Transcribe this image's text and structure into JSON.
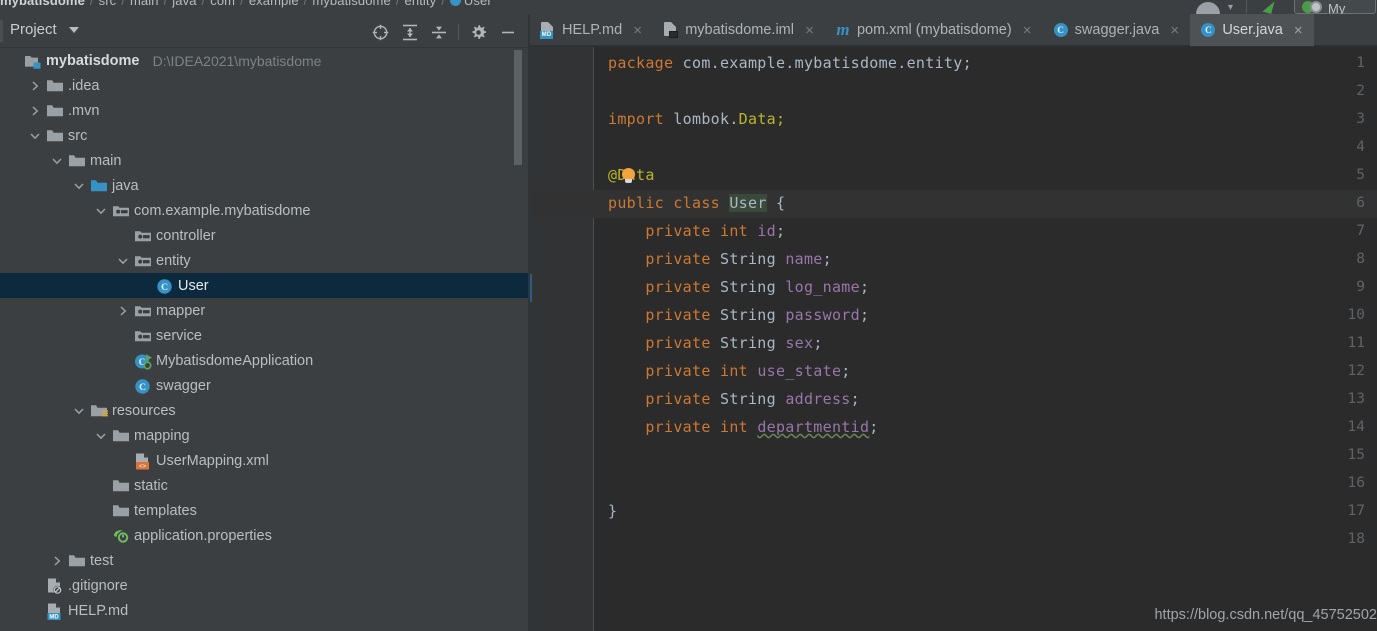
{
  "breadcrumb": {
    "items": [
      "mybatisdome",
      "src",
      "main",
      "java",
      "com",
      "example",
      "mybatisdome",
      "entity",
      "User"
    ],
    "separator": "/"
  },
  "toolbar_right": {
    "module_label": "My"
  },
  "project_panel": {
    "title": "Project",
    "caret_icon": "chevron-down-icon",
    "tools": [
      {
        "name": "select-opened-file-icon",
        "label": "Select Opened File"
      },
      {
        "name": "expand-all-icon",
        "label": "Expand All"
      },
      {
        "name": "collapse-all-icon",
        "label": "Collapse All"
      },
      {
        "name": "gear-icon",
        "label": "Settings"
      },
      {
        "name": "minimize-icon",
        "label": "Hide"
      }
    ],
    "tree": [
      {
        "label": "mybatisdome",
        "path": "D:\\IDEA2021\\mybatisdome",
        "depth": 0,
        "arrow": "none",
        "icon": "module-icon",
        "bold": true,
        "selected": false
      },
      {
        "label": ".idea",
        "path": "",
        "depth": 1,
        "arrow": "collapsed",
        "icon": "folder-icon",
        "bold": false,
        "selected": false
      },
      {
        "label": ".mvn",
        "path": "",
        "depth": 1,
        "arrow": "collapsed",
        "icon": "folder-icon",
        "bold": false,
        "selected": false
      },
      {
        "label": "src",
        "path": "",
        "depth": 1,
        "arrow": "expanded",
        "icon": "folder-icon",
        "bold": false,
        "selected": false
      },
      {
        "label": "main",
        "path": "",
        "depth": 2,
        "arrow": "expanded",
        "icon": "folder-icon",
        "bold": false,
        "selected": false
      },
      {
        "label": "java",
        "path": "",
        "depth": 3,
        "arrow": "expanded",
        "icon": "source-root-icon",
        "bold": false,
        "selected": false
      },
      {
        "label": "com.example.mybatisdome",
        "path": "",
        "depth": 4,
        "arrow": "expanded",
        "icon": "package-icon",
        "bold": false,
        "selected": false
      },
      {
        "label": "controller",
        "path": "",
        "depth": 5,
        "arrow": "none",
        "icon": "package-icon",
        "bold": false,
        "selected": false
      },
      {
        "label": "entity",
        "path": "",
        "depth": 5,
        "arrow": "expanded",
        "icon": "package-icon",
        "bold": false,
        "selected": false
      },
      {
        "label": "User",
        "path": "",
        "depth": 6,
        "arrow": "none",
        "icon": "java-class-icon",
        "bold": false,
        "selected": true
      },
      {
        "label": "mapper",
        "path": "",
        "depth": 5,
        "arrow": "collapsed",
        "icon": "package-icon",
        "bold": false,
        "selected": false
      },
      {
        "label": "service",
        "path": "",
        "depth": 5,
        "arrow": "none",
        "icon": "package-icon",
        "bold": false,
        "selected": false
      },
      {
        "label": "MybatisdomeApplication",
        "path": "",
        "depth": 5,
        "arrow": "none",
        "icon": "spring-class-icon",
        "bold": false,
        "selected": false
      },
      {
        "label": "swagger",
        "path": "",
        "depth": 5,
        "arrow": "none",
        "icon": "java-class-icon",
        "bold": false,
        "selected": false
      },
      {
        "label": "resources",
        "path": "",
        "depth": 3,
        "arrow": "expanded",
        "icon": "resource-root-icon",
        "bold": false,
        "selected": false
      },
      {
        "label": "mapping",
        "path": "",
        "depth": 4,
        "arrow": "expanded",
        "icon": "folder-icon",
        "bold": false,
        "selected": false
      },
      {
        "label": "UserMapping.xml",
        "path": "",
        "depth": 5,
        "arrow": "none",
        "icon": "xml-file-icon",
        "bold": false,
        "selected": false
      },
      {
        "label": "static",
        "path": "",
        "depth": 4,
        "arrow": "none",
        "icon": "folder-icon",
        "bold": false,
        "selected": false
      },
      {
        "label": "templates",
        "path": "",
        "depth": 4,
        "arrow": "none",
        "icon": "folder-icon",
        "bold": false,
        "selected": false
      },
      {
        "label": "application.properties",
        "path": "",
        "depth": 4,
        "arrow": "none",
        "icon": "spring-properties-icon",
        "bold": false,
        "selected": false
      },
      {
        "label": "test",
        "path": "",
        "depth": 2,
        "arrow": "collapsed",
        "icon": "folder-icon",
        "bold": false,
        "selected": false
      },
      {
        "label": ".gitignore",
        "path": "",
        "depth": 1,
        "arrow": "none",
        "icon": "gitignore-icon",
        "bold": false,
        "selected": false
      },
      {
        "label": "HELP.md",
        "path": "",
        "depth": 1,
        "arrow": "none",
        "icon": "markdown-file-icon",
        "bold": false,
        "selected": false
      }
    ]
  },
  "editor": {
    "tabs": [
      {
        "label": "HELP.md",
        "icon": "markdown-file-icon",
        "active": false,
        "close": "×"
      },
      {
        "label": "mybatisdome.iml",
        "icon": "iml-file-icon",
        "active": false,
        "close": "×"
      },
      {
        "label": "pom.xml (mybatisdome)",
        "icon": "maven-file-icon",
        "active": false,
        "close": "×"
      },
      {
        "label": "swagger.java",
        "icon": "java-class-icon",
        "active": false,
        "close": "×"
      },
      {
        "label": "User.java",
        "icon": "java-class-icon",
        "active": true,
        "close": "×"
      }
    ],
    "caret_line": 6,
    "line_numbers": [
      "1",
      "2",
      "3",
      "4",
      "5",
      "6",
      "7",
      "8",
      "9",
      "10",
      "11",
      "12",
      "13",
      "14",
      "15",
      "16",
      "17",
      "18"
    ],
    "code_lines": [
      {
        "n": 1,
        "segments": [
          {
            "t": "package ",
            "c": "kw"
          },
          {
            "t": "com.example.mybatisdome.entity;",
            "c": "pkg"
          }
        ]
      },
      {
        "n": 2,
        "segments": []
      },
      {
        "n": 3,
        "segments": [
          {
            "t": "import ",
            "c": "kw"
          },
          {
            "t": "lombok.",
            "c": "pkg"
          },
          {
            "t": "Data;",
            "c": "ann"
          }
        ]
      },
      {
        "n": 4,
        "segments": []
      },
      {
        "n": 5,
        "segments": [
          {
            "t": "@Data",
            "c": "ann"
          }
        ]
      },
      {
        "n": 6,
        "segments": [
          {
            "t": "public ",
            "c": "kw"
          },
          {
            "t": "class ",
            "c": "kw"
          },
          {
            "t": "User",
            "c": "cls-nm hl-ident"
          },
          {
            "t": " {",
            "c": "pkg"
          }
        ]
      },
      {
        "n": 7,
        "segments": [
          {
            "t": "    ",
            "c": "pkg"
          },
          {
            "t": "private ",
            "c": "kw"
          },
          {
            "t": "int ",
            "c": "kw"
          },
          {
            "t": "id",
            "c": "fld"
          },
          {
            "t": ";",
            "c": "pkg"
          }
        ]
      },
      {
        "n": 8,
        "segments": [
          {
            "t": "    ",
            "c": "pkg"
          },
          {
            "t": "private ",
            "c": "kw"
          },
          {
            "t": "String ",
            "c": "pkg"
          },
          {
            "t": "name",
            "c": "fld"
          },
          {
            "t": ";",
            "c": "pkg"
          }
        ]
      },
      {
        "n": 9,
        "segments": [
          {
            "t": "    ",
            "c": "pkg"
          },
          {
            "t": "private ",
            "c": "kw"
          },
          {
            "t": "String ",
            "c": "pkg"
          },
          {
            "t": "log_name",
            "c": "fld"
          },
          {
            "t": ";",
            "c": "pkg"
          }
        ]
      },
      {
        "n": 10,
        "segments": [
          {
            "t": "    ",
            "c": "pkg"
          },
          {
            "t": "private ",
            "c": "kw"
          },
          {
            "t": "String ",
            "c": "pkg"
          },
          {
            "t": "password",
            "c": "fld"
          },
          {
            "t": ";",
            "c": "pkg"
          }
        ]
      },
      {
        "n": 11,
        "segments": [
          {
            "t": "    ",
            "c": "pkg"
          },
          {
            "t": "private ",
            "c": "kw"
          },
          {
            "t": "String ",
            "c": "pkg"
          },
          {
            "t": "sex",
            "c": "fld"
          },
          {
            "t": ";",
            "c": "pkg"
          }
        ]
      },
      {
        "n": 12,
        "segments": [
          {
            "t": "    ",
            "c": "pkg"
          },
          {
            "t": "private ",
            "c": "kw"
          },
          {
            "t": "int ",
            "c": "kw"
          },
          {
            "t": "use_state",
            "c": "fld"
          },
          {
            "t": ";",
            "c": "pkg"
          }
        ]
      },
      {
        "n": 13,
        "segments": [
          {
            "t": "    ",
            "c": "pkg"
          },
          {
            "t": "private ",
            "c": "kw"
          },
          {
            "t": "String ",
            "c": "pkg"
          },
          {
            "t": "address",
            "c": "fld"
          },
          {
            "t": ";",
            "c": "pkg"
          }
        ]
      },
      {
        "n": 14,
        "segments": [
          {
            "t": "    ",
            "c": "pkg"
          },
          {
            "t": "private ",
            "c": "kw"
          },
          {
            "t": "int ",
            "c": "kw"
          },
          {
            "t": "departmentid",
            "c": "fld typo"
          },
          {
            "t": ";",
            "c": "pkg"
          }
        ]
      },
      {
        "n": 15,
        "segments": []
      },
      {
        "n": 16,
        "segments": []
      },
      {
        "n": 17,
        "segments": [
          {
            "t": "}",
            "c": "pkg"
          }
        ]
      },
      {
        "n": 18,
        "segments": []
      }
    ],
    "intention_bulb": {
      "name": "intention-bulb-icon",
      "line": 5
    },
    "watermark": "https://blog.csdn.net/qq_45752502"
  },
  "colors": {
    "editor_bg": "#2b2b2b",
    "gutter_bg": "#313335",
    "panel_bg": "#3c3f41",
    "selection_bg": "#0d293e",
    "caret_line_bg": "#323232",
    "keyword": "#cc7832",
    "field": "#9876aa",
    "annotation": "#bbb529",
    "text": "#a9b7c6",
    "accent": "#3592c4"
  }
}
